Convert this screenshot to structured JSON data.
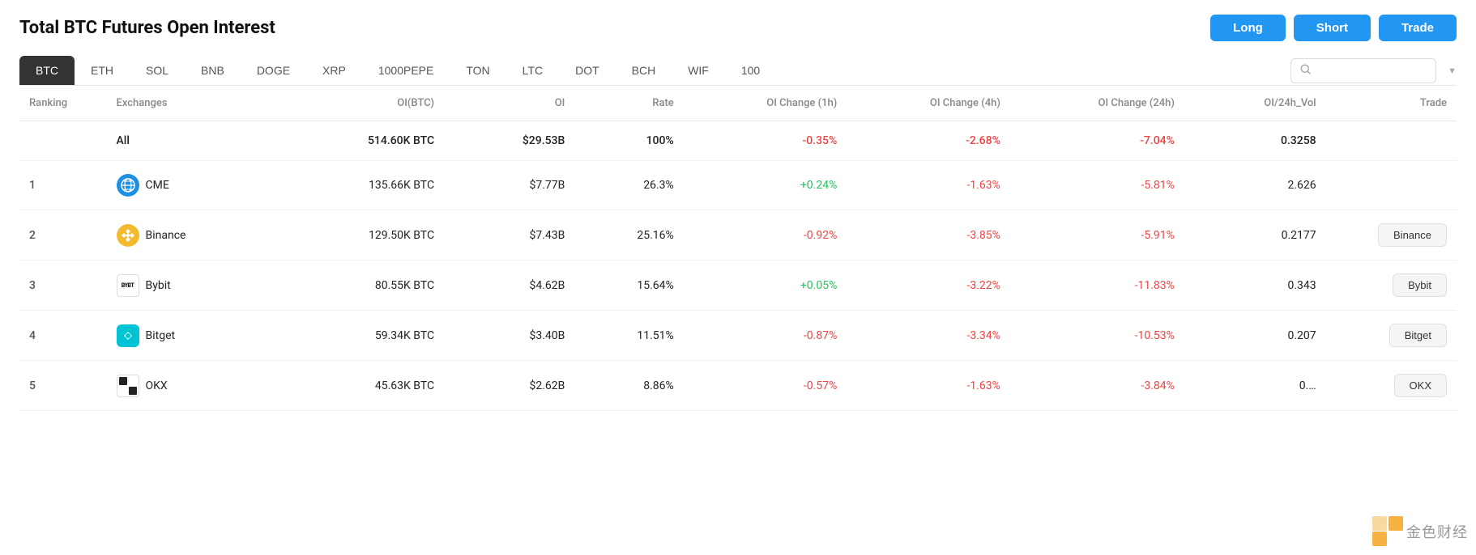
{
  "title": "Total BTC Futures Open Interest",
  "buttons": {
    "long": "Long",
    "short": "Short",
    "trade": "Trade"
  },
  "coins": [
    {
      "id": "btc",
      "label": "BTC",
      "active": true
    },
    {
      "id": "eth",
      "label": "ETH",
      "active": false
    },
    {
      "id": "sol",
      "label": "SOL",
      "active": false
    },
    {
      "id": "bnb",
      "label": "BNB",
      "active": false
    },
    {
      "id": "doge",
      "label": "DOGE",
      "active": false
    },
    {
      "id": "xrp",
      "label": "XRP",
      "active": false
    },
    {
      "id": "1000pepe",
      "label": "1000PEPE",
      "active": false
    },
    {
      "id": "ton",
      "label": "TON",
      "active": false
    },
    {
      "id": "ltc",
      "label": "LTC",
      "active": false
    },
    {
      "id": "dot",
      "label": "DOT",
      "active": false
    },
    {
      "id": "bch",
      "label": "BCH",
      "active": false
    },
    {
      "id": "wif",
      "label": "WIF",
      "active": false
    },
    {
      "id": "100x",
      "label": "100",
      "active": false
    }
  ],
  "search": {
    "placeholder": ""
  },
  "columns": [
    "Ranking",
    "Exchanges",
    "OI(BTC)",
    "OI",
    "Rate",
    "OI Change (1h)",
    "OI Change (4h)",
    "OI Change (24h)",
    "OI/24h_Vol",
    "Trade"
  ],
  "rows": [
    {
      "rank": "",
      "exchange": "All",
      "exchange_id": "all",
      "oi_btc": "514.60K BTC",
      "oi": "$29.53B",
      "rate": "100%",
      "oi_change_1h": "-0.35%",
      "oi_change_1h_type": "negative",
      "oi_change_4h": "-2.68%",
      "oi_change_4h_type": "negative",
      "oi_change_24h": "-7.04%",
      "oi_change_24h_type": "negative",
      "oi_24h_vol": "0.3258",
      "trade_label": "",
      "show_trade": false
    },
    {
      "rank": "1",
      "exchange": "CME",
      "exchange_id": "cme",
      "oi_btc": "135.66K BTC",
      "oi": "$7.77B",
      "rate": "26.3%",
      "oi_change_1h": "+0.24%",
      "oi_change_1h_type": "positive",
      "oi_change_4h": "-1.63%",
      "oi_change_4h_type": "negative",
      "oi_change_24h": "-5.81%",
      "oi_change_24h_type": "negative",
      "oi_24h_vol": "2.626",
      "trade_label": "",
      "show_trade": false
    },
    {
      "rank": "2",
      "exchange": "Binance",
      "exchange_id": "binance",
      "oi_btc": "129.50K BTC",
      "oi": "$7.43B",
      "rate": "25.16%",
      "oi_change_1h": "-0.92%",
      "oi_change_1h_type": "negative",
      "oi_change_4h": "-3.85%",
      "oi_change_4h_type": "negative",
      "oi_change_24h": "-5.91%",
      "oi_change_24h_type": "negative",
      "oi_24h_vol": "0.2177",
      "trade_label": "Binance",
      "show_trade": true
    },
    {
      "rank": "3",
      "exchange": "Bybit",
      "exchange_id": "bybit",
      "oi_btc": "80.55K BTC",
      "oi": "$4.62B",
      "rate": "15.64%",
      "oi_change_1h": "+0.05%",
      "oi_change_1h_type": "positive",
      "oi_change_4h": "-3.22%",
      "oi_change_4h_type": "negative",
      "oi_change_24h": "-11.83%",
      "oi_change_24h_type": "negative",
      "oi_24h_vol": "0.343",
      "trade_label": "Bybit",
      "show_trade": true
    },
    {
      "rank": "4",
      "exchange": "Bitget",
      "exchange_id": "bitget",
      "oi_btc": "59.34K BTC",
      "oi": "$3.40B",
      "rate": "11.51%",
      "oi_change_1h": "-0.87%",
      "oi_change_1h_type": "negative",
      "oi_change_4h": "-3.34%",
      "oi_change_4h_type": "negative",
      "oi_change_24h": "-10.53%",
      "oi_change_24h_type": "negative",
      "oi_24h_vol": "0.207",
      "trade_label": "Bitget",
      "show_trade": true
    },
    {
      "rank": "5",
      "exchange": "OKX",
      "exchange_id": "okx",
      "oi_btc": "45.63K BTC",
      "oi": "$2.62B",
      "rate": "8.86%",
      "oi_change_1h": "-0.57%",
      "oi_change_1h_type": "negative",
      "oi_change_4h": "-1.63%",
      "oi_change_4h_type": "negative",
      "oi_change_24h": "-3.84%",
      "oi_change_24h_type": "negative",
      "oi_24h_vol": "0.…",
      "trade_label": "OKX",
      "show_trade": true
    }
  ]
}
